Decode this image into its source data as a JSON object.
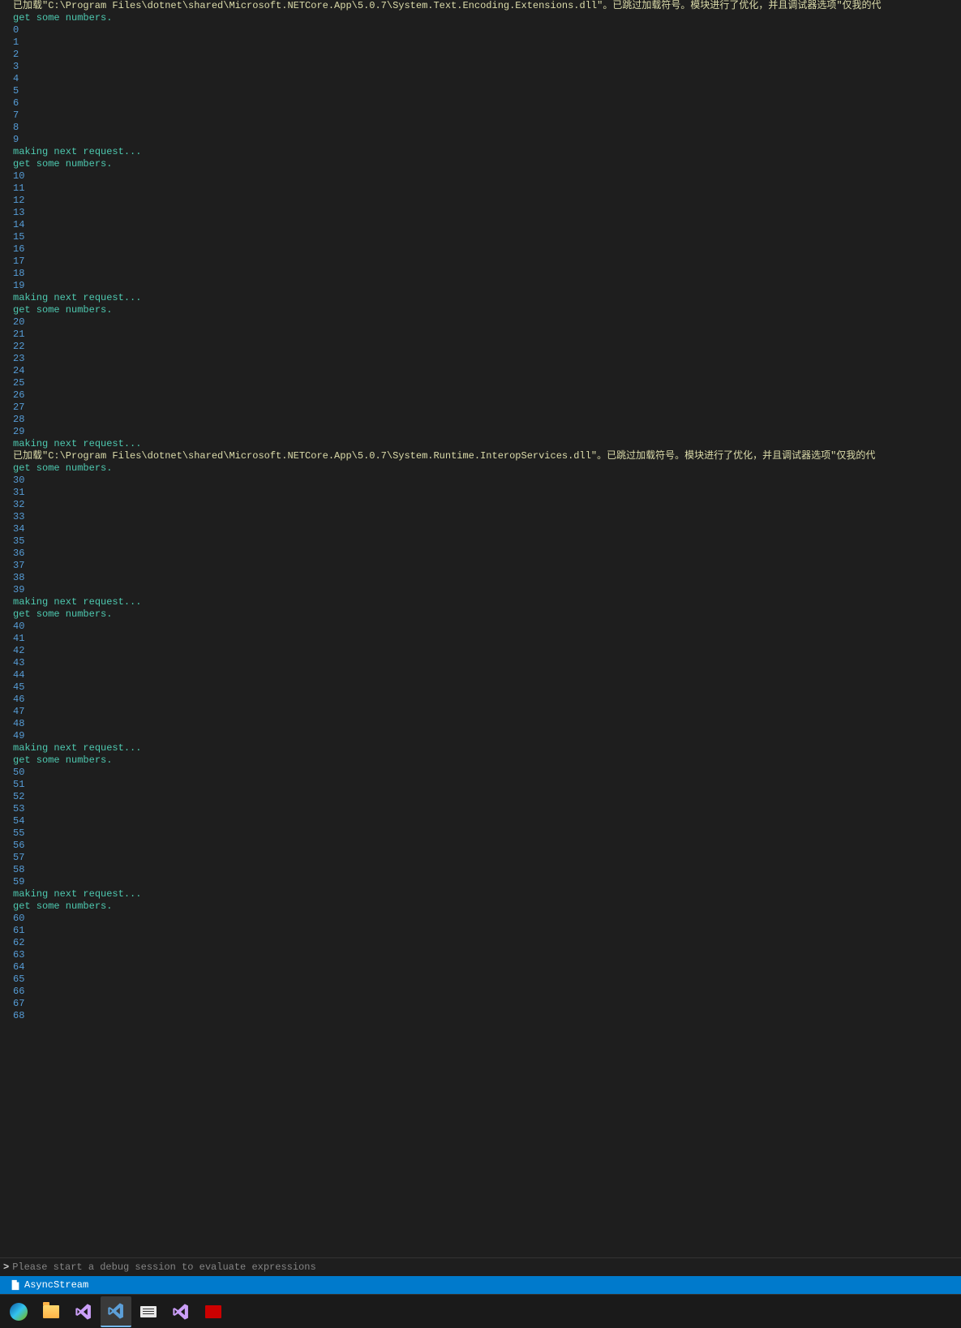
{
  "output": {
    "top_msg": "已加载\"C:\\Program Files\\dotnet\\shared\\Microsoft.NETCore.App\\5.0.7\\System.Text.Encoding.Extensions.dll\"。已跳过加载符号。模块进行了优化，并且调试器选项\"仅我的代",
    "loaded_msg": "已加载\"C:\\Program Files\\dotnet\\shared\\Microsoft.NETCore.App\\5.0.7\\System.Runtime.InteropServices.dll\"。已跳过加载符号。模块进行了优化，并且调试器选项\"仅我的代",
    "get_numbers": "get some numbers.",
    "making_request": "making next request...",
    "blocks": [
      {
        "range": [
          0,
          9
        ]
      },
      {
        "range": [
          10,
          19
        ]
      },
      {
        "range": [
          20,
          29
        ]
      },
      {
        "range": [
          30,
          39
        ],
        "loaded_before_get": true
      },
      {
        "range": [
          40,
          49
        ]
      },
      {
        "range": [
          50,
          59
        ]
      },
      {
        "range": [
          60,
          68
        ],
        "no_trailer": true
      }
    ]
  },
  "repl": {
    "placeholder": "Please start a debug session to evaluate expressions",
    "value": ""
  },
  "status_bar": {
    "project_name": "AsyncStream"
  },
  "taskbar": {
    "items": [
      {
        "name": "edge",
        "type": "edge"
      },
      {
        "name": "explorer",
        "type": "explorer"
      },
      {
        "name": "vs-purple-1",
        "type": "vs-purple",
        "active": false
      },
      {
        "name": "vs-blue",
        "type": "vs-blue",
        "active": true
      },
      {
        "name": "typora",
        "type": "typora"
      },
      {
        "name": "vs-purple-2",
        "type": "vs-purple"
      },
      {
        "name": "red-app",
        "type": "red"
      }
    ]
  }
}
